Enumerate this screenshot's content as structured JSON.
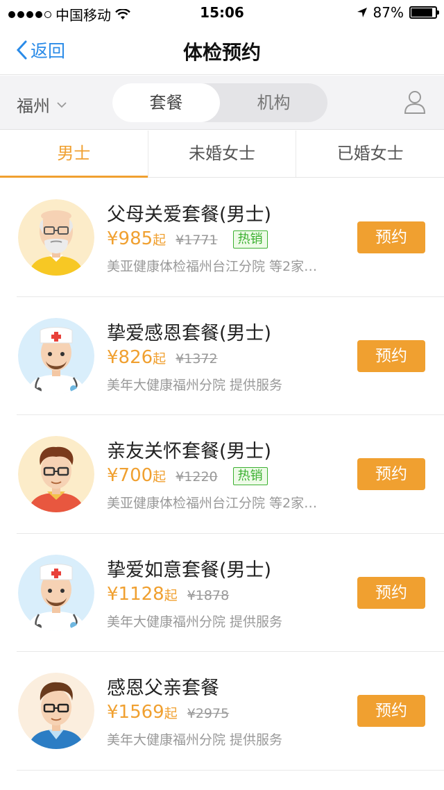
{
  "status_bar": {
    "carrier": "中国移动",
    "time": "15:06",
    "battery": "87%",
    "battery_level": 0.87
  },
  "nav": {
    "back_label": "返回",
    "title": "体检预约"
  },
  "filter": {
    "city": "福州",
    "segments": [
      "套餐",
      "机构"
    ],
    "active_segment": 0
  },
  "tabs": [
    "男士",
    "未婚女士",
    "已婚女士"
  ],
  "active_tab": 0,
  "packages": [
    {
      "name": "父母关爱套餐(男士)",
      "price": "¥985",
      "suffix": "起",
      "original": "¥1771",
      "hot": "热销",
      "provider": "美亚健康体检福州台江分院 等2家…",
      "book": "预约",
      "avatar": "elderly-man"
    },
    {
      "name": "挚爱感恩套餐(男士)",
      "price": "¥826",
      "suffix": "起",
      "original": "¥1372",
      "hot": "",
      "provider": "美年大健康福州分院 提供服务",
      "book": "预约",
      "avatar": "doctor"
    },
    {
      "name": "亲友关怀套餐(男士)",
      "price": "¥700",
      "suffix": "起",
      "original": "¥1220",
      "hot": "热销",
      "provider": "美亚健康体检福州台江分院 等2家…",
      "book": "预约",
      "avatar": "young-man"
    },
    {
      "name": "挚爱如意套餐(男士)",
      "price": "¥1128",
      "suffix": "起",
      "original": "¥1878",
      "hot": "",
      "provider": "美年大健康福州分院 提供服务",
      "book": "预约",
      "avatar": "doctor"
    },
    {
      "name": "感恩父亲套餐",
      "price": "¥1569",
      "suffix": "起",
      "original": "¥2975",
      "hot": "",
      "provider": "美年大健康福州分院 提供服务",
      "book": "预约",
      "avatar": "father"
    }
  ]
}
